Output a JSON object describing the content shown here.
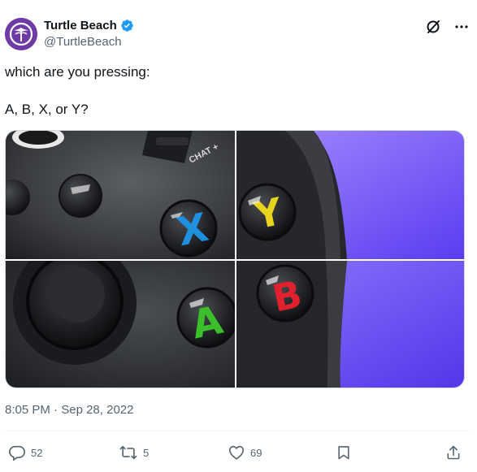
{
  "author": {
    "display_name": "Turtle Beach",
    "handle": "@TurtleBeach",
    "verified": true
  },
  "tweet": {
    "lines": [
      "which are you pressing:",
      "A, B, X, or Y?"
    ]
  },
  "media": {
    "overlay_text": "CHAT +",
    "buttons": [
      {
        "letter": "X",
        "color": "#1f8fe0"
      },
      {
        "letter": "Y",
        "color": "#e8d51e"
      },
      {
        "letter": "A",
        "color": "#3bbf2a"
      },
      {
        "letter": "B",
        "color": "#e0202c"
      }
    ]
  },
  "meta": {
    "time": "8:05 PM",
    "separator": " · ",
    "date": "Sep 28, 2022"
  },
  "actions": {
    "replies": "52",
    "retweets": "5",
    "likes": "69"
  },
  "colors": {
    "text": "#0f1419",
    "secondary": "#536471",
    "verified": "#1d9bf0",
    "avatar_bg": "#6e3aa8"
  }
}
